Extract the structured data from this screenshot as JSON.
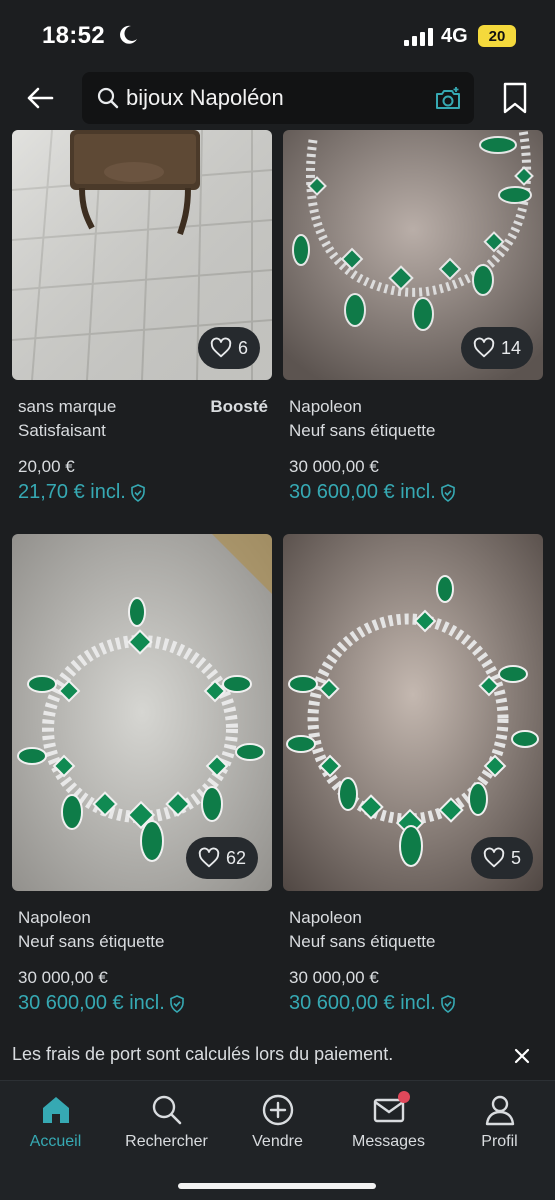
{
  "status_bar": {
    "time": "18:52",
    "network": "4G",
    "battery": "20"
  },
  "search": {
    "query": "bijoux Napoléon"
  },
  "items": [
    {
      "brand": "sans marque",
      "boosted": "Boosté",
      "condition": "Satisfaisant",
      "price": "20,00 €",
      "price_incl": "21,70 € incl.",
      "favorites": "6",
      "image": "miniature-bronze-stove"
    },
    {
      "brand": "Napoleon",
      "boosted": "",
      "condition": "Neuf sans étiquette",
      "price": "30 000,00 €",
      "price_incl": "30 600,00 € incl.",
      "favorites": "14",
      "image": "emerald-diamond-necklace"
    },
    {
      "brand": "Napoleon",
      "boosted": "",
      "condition": "Neuf sans étiquette",
      "price": "30 000,00 €",
      "price_incl": "30 600,00 € incl.",
      "favorites": "62",
      "image": "emerald-diamond-necklace"
    },
    {
      "brand": "Napoleon",
      "boosted": "",
      "condition": "Neuf sans étiquette",
      "price": "30 000,00 €",
      "price_incl": "30 600,00 € incl.",
      "favorites": "5",
      "image": "emerald-diamond-necklace"
    }
  ],
  "banner": {
    "text": "Les frais de port sont calculés lors du paiement."
  },
  "nav": [
    {
      "label": "Accueil",
      "icon": "home-icon",
      "active": true
    },
    {
      "label": "Rechercher",
      "icon": "search-icon"
    },
    {
      "label": "Vendre",
      "icon": "plus-circle-icon"
    },
    {
      "label": "Messages",
      "icon": "mail-icon",
      "badge": true
    },
    {
      "label": "Profil",
      "icon": "profile-icon"
    }
  ],
  "colors": {
    "accent": "#36a9b3",
    "background": "#1c1e20",
    "badge": "#e0485a"
  }
}
